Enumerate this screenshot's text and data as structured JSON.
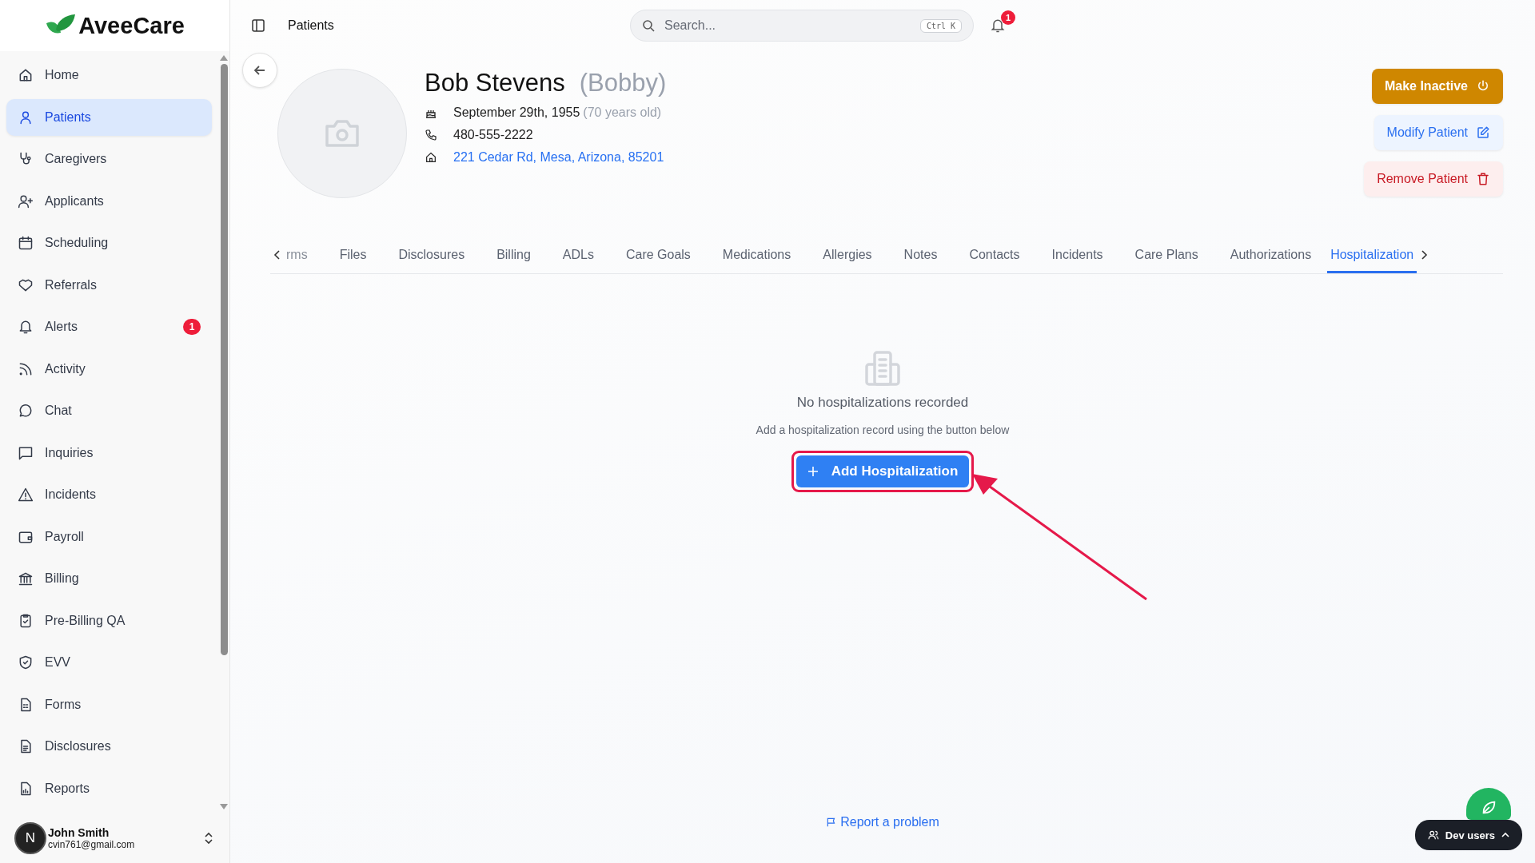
{
  "logo": {
    "text": "AveeCare"
  },
  "sidebar": {
    "items": [
      {
        "label": "Home",
        "selected": false
      },
      {
        "label": "Patients",
        "selected": true
      },
      {
        "label": "Caregivers",
        "selected": false
      },
      {
        "label": "Applicants",
        "selected": false
      },
      {
        "label": "Scheduling",
        "selected": false
      },
      {
        "label": "Referrals",
        "selected": false
      },
      {
        "label": "Alerts",
        "selected": false,
        "badge": "1"
      },
      {
        "label": "Activity",
        "selected": false
      },
      {
        "label": "Chat",
        "selected": false
      },
      {
        "label": "Inquiries",
        "selected": false
      },
      {
        "label": "Incidents",
        "selected": false
      },
      {
        "label": "Payroll",
        "selected": false
      },
      {
        "label": "Billing",
        "selected": false
      },
      {
        "label": "Pre-Billing QA",
        "selected": false
      },
      {
        "label": "EVV",
        "selected": false
      },
      {
        "label": "Forms",
        "selected": false
      },
      {
        "label": "Disclosures",
        "selected": false
      },
      {
        "label": "Reports",
        "selected": false
      }
    ]
  },
  "user": {
    "initial": "N",
    "name": "John Smith",
    "email": "cvin761@gmail.com"
  },
  "header": {
    "title": "Patients",
    "search": {
      "placeholder": "Search...",
      "shortcut": "Ctrl K"
    },
    "notifications_badge": "1"
  },
  "patient": {
    "name": "Bob Stevens",
    "nickname": "(Bobby)",
    "birth_date": "September 29th, 1955",
    "age": "(70 years old)",
    "phone": "480-555-2222",
    "address": "221 Cedar Rd, Mesa, Arizona, 85201"
  },
  "actions": [
    {
      "kind": "warning",
      "label": "Make Inactive"
    },
    {
      "kind": "primary",
      "label": "Modify Patient"
    },
    {
      "kind": "danger",
      "label": "Remove Patient"
    }
  ],
  "tabs": [
    {
      "label": "rms",
      "selected": false
    },
    {
      "label": "Files",
      "selected": false
    },
    {
      "label": "Disclosures",
      "selected": false
    },
    {
      "label": "Billing",
      "selected": false
    },
    {
      "label": "ADLs",
      "selected": false
    },
    {
      "label": "Care Goals",
      "selected": false
    },
    {
      "label": "Medications",
      "selected": false
    },
    {
      "label": "Allergies",
      "selected": false
    },
    {
      "label": "Notes",
      "selected": false
    },
    {
      "label": "Contacts",
      "selected": false
    },
    {
      "label": "Incidents",
      "selected": false
    },
    {
      "label": "Care Plans",
      "selected": false
    },
    {
      "label": "Authorizations",
      "selected": false
    },
    {
      "label": "Hospitalization",
      "selected": true
    }
  ],
  "empty_state": {
    "title": "No hospitalizations recorded",
    "subtitle": "Add a hospitalization record using the button below",
    "button": "Add Hospitalization",
    "highlighted": true
  },
  "report_link": "Report a problem",
  "dev_users": "Dev users"
}
